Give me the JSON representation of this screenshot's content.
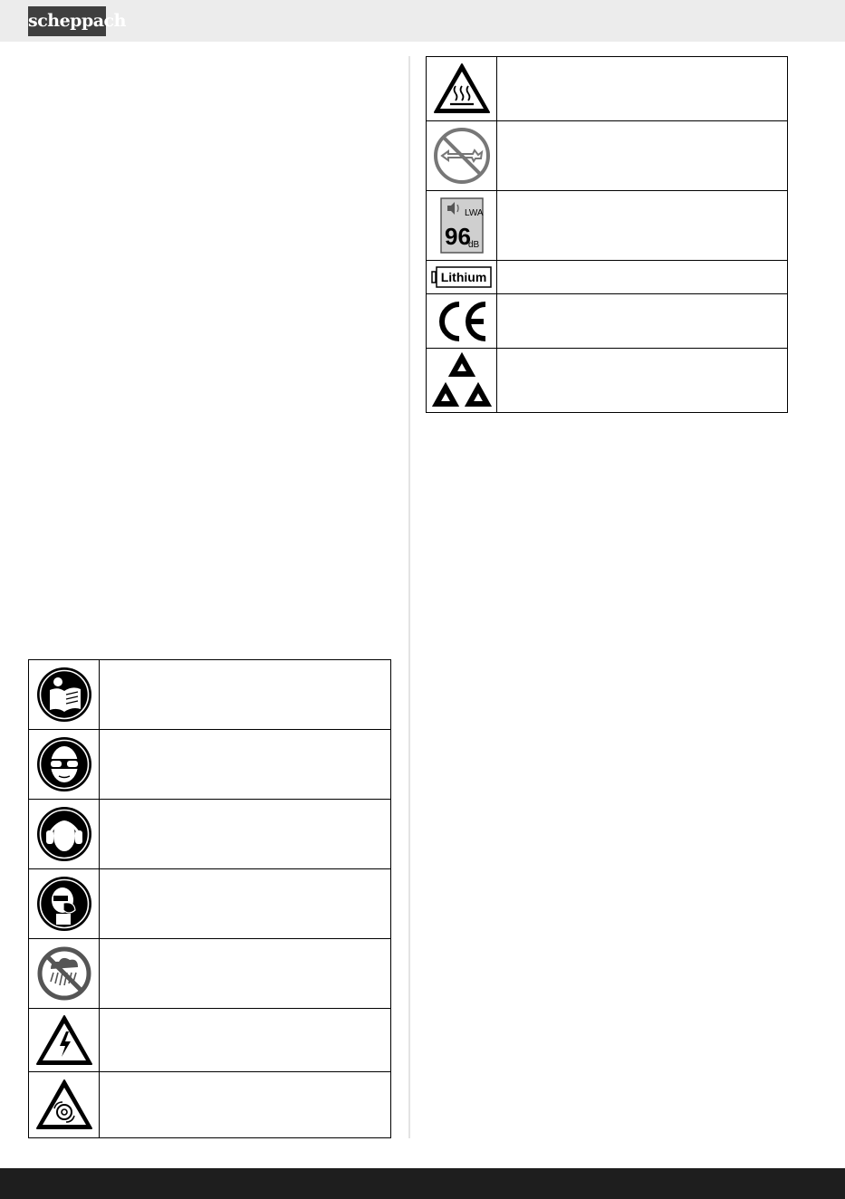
{
  "header": {
    "logo_text": "scheppach",
    "background": "#ececec",
    "logo_bg": "#3f3f3f"
  },
  "footer": {
    "background": "#1e1e1e"
  },
  "left_table": {
    "rows": [
      {
        "icon": "read-manual-icon"
      },
      {
        "icon": "eye-protection-icon"
      },
      {
        "icon": "hearing-protection-icon"
      },
      {
        "icon": "respiratory-protection-icon"
      },
      {
        "icon": "no-rain-icon"
      },
      {
        "icon": "electric-shock-warning-icon"
      },
      {
        "icon": "rotating-parts-warning-icon"
      }
    ]
  },
  "right_table": {
    "rows": [
      {
        "icon": "hot-surface-warning-icon"
      },
      {
        "icon": "no-cutting-hazard-icon"
      },
      {
        "icon": "sound-power-level-icon",
        "lwa_label": "LWA",
        "db_value": "96",
        "db_unit": "dB"
      },
      {
        "icon": "lithium-battery-icon",
        "label": "Lithium"
      },
      {
        "icon": "ce-mark-icon"
      },
      {
        "icon": "recycling-icon"
      }
    ]
  }
}
